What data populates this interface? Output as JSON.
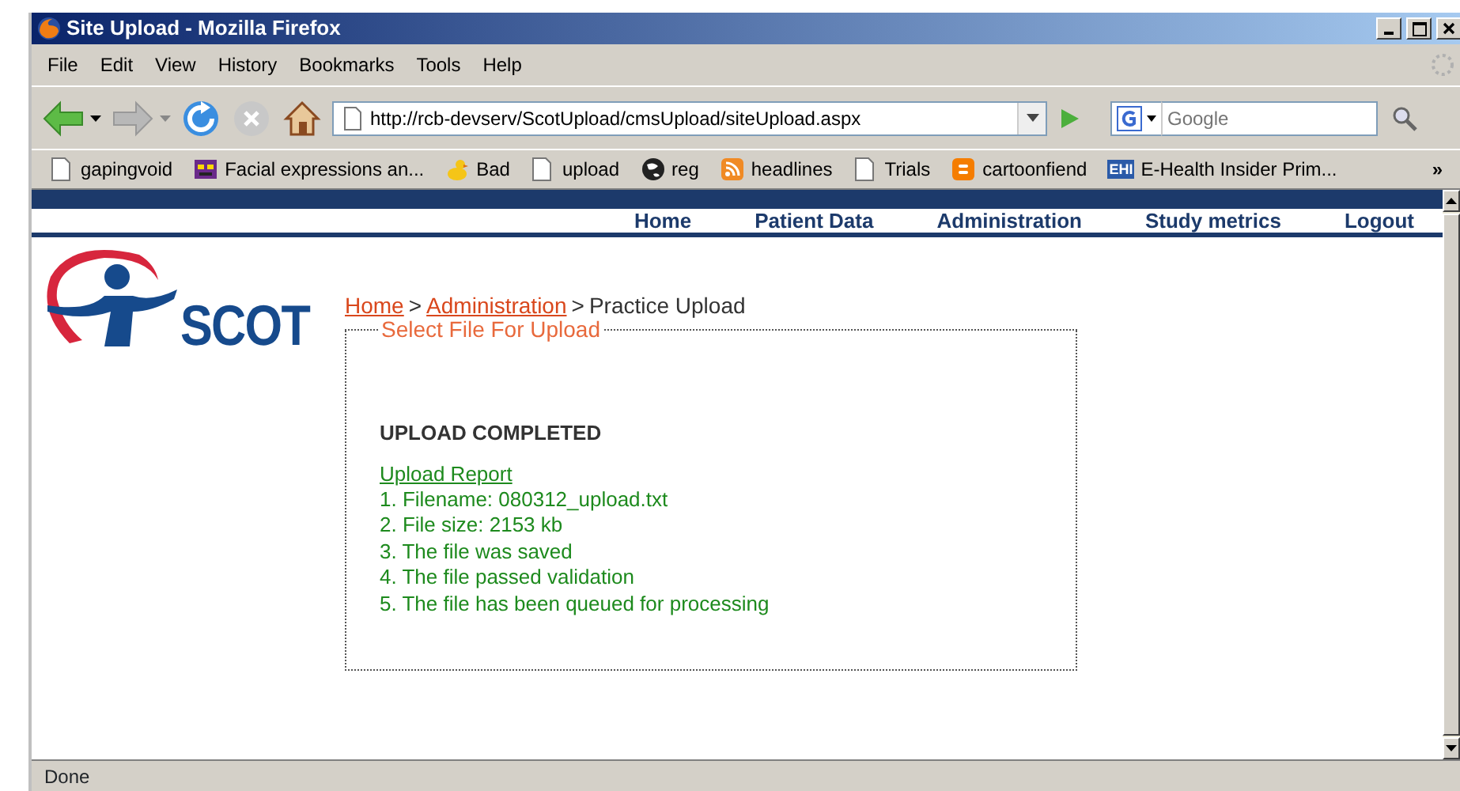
{
  "window": {
    "title": "Site Upload - Mozilla Firefox"
  },
  "menu": [
    {
      "label": "File"
    },
    {
      "label": "Edit"
    },
    {
      "label": "View"
    },
    {
      "label": "History"
    },
    {
      "label": "Bookmarks"
    },
    {
      "label": "Tools"
    },
    {
      "label": "Help"
    }
  ],
  "toolbar": {
    "back_disabled": false,
    "forward_disabled": true,
    "stop_disabled": true
  },
  "address": {
    "value": "http://rcb-devserv/ScotUpload/cmsUpload/siteUpload.aspx"
  },
  "search": {
    "placeholder": "Google"
  },
  "bookmarks": [
    {
      "label": "gapingvoid",
      "kind": "page"
    },
    {
      "label": "Facial expressions an...",
      "kind": "face"
    },
    {
      "label": "Bad",
      "kind": "duck"
    },
    {
      "label": "upload",
      "kind": "page"
    },
    {
      "label": "reg",
      "kind": "globe"
    },
    {
      "label": "headlines",
      "kind": "feed"
    },
    {
      "label": "Trials",
      "kind": "page"
    },
    {
      "label": "cartoonfiend",
      "kind": "blog"
    },
    {
      "label": "E-Health Insider Prim...",
      "kind": "badge",
      "badge": "EHI"
    }
  ],
  "bookmarks_overflow": "»",
  "site": {
    "logo": "SCOT",
    "nav": [
      "Home",
      "Patient Data",
      "Administration",
      "Study metrics",
      "Logout"
    ],
    "breadcrumb": [
      {
        "kind": "link",
        "text": "Home"
      },
      {
        "kind": "separator",
        "text": ">"
      },
      {
        "kind": "link",
        "text": "Administration"
      },
      {
        "kind": "separator",
        "text": ">"
      },
      {
        "kind": "current",
        "text": "Practice Upload"
      }
    ],
    "upload": {
      "legend": "Select File For Upload",
      "heading": "UPLOAD COMPLETED",
      "report_link": "Upload Report",
      "lines": [
        "1. Filename: 080312_upload.txt",
        "2. File size: 2153 kb",
        "3. The file was saved",
        "4. The file passed validation",
        "5. The file has been queued for processing"
      ]
    }
  },
  "status_bar": "Done"
}
